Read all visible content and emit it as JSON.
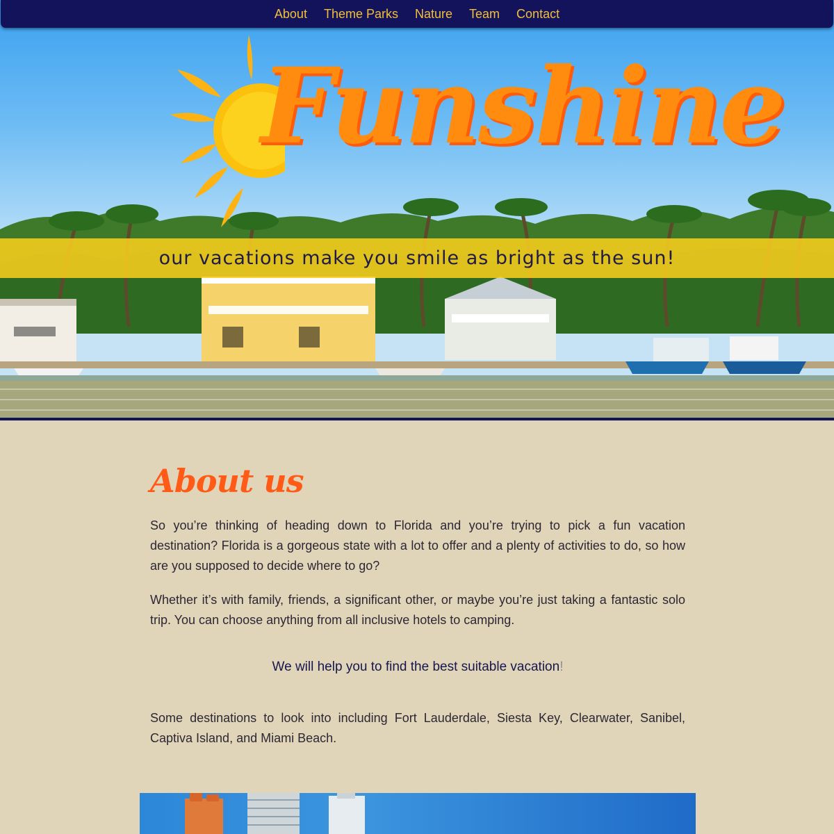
{
  "nav": {
    "items": [
      "About",
      "Theme Parks",
      "Nature",
      "Team",
      "Contact"
    ]
  },
  "hero": {
    "brand": "Funshine",
    "tagline": "our vacations make you smile as bright as the sun!"
  },
  "about": {
    "heading": "About us",
    "paragraphs": [
      "So you’re thinking of heading down to Florida and you’re trying to pick a fun vacation destination? Florida is a gorgeous state with a lot to offer and a plenty of activities to do, so how are you supposed to decide where to go?",
      "Whether it’s with family, friends, a significant other, or maybe you’re just taking a fantastic solo trip. You can choose anything from all inclusive hotels to camping.",
      "Some destinations to look into including Fort Lauderdale, Siesta Key, Clearwater, Sanibel, Captiva Island, and Miami Beach."
    ],
    "cta_text": "We will help you to find the best suitable vacation",
    "cta_punct": "!"
  },
  "colors": {
    "nav_bg": "#12135a",
    "nav_text": "#f3bf3a",
    "page_bg": "#e1d5b9",
    "heading": "#ff5b16",
    "brand": "#ff8c0e",
    "tagline_band": "#f8cd1d"
  },
  "icons": [
    "sun-logo-icon"
  ]
}
